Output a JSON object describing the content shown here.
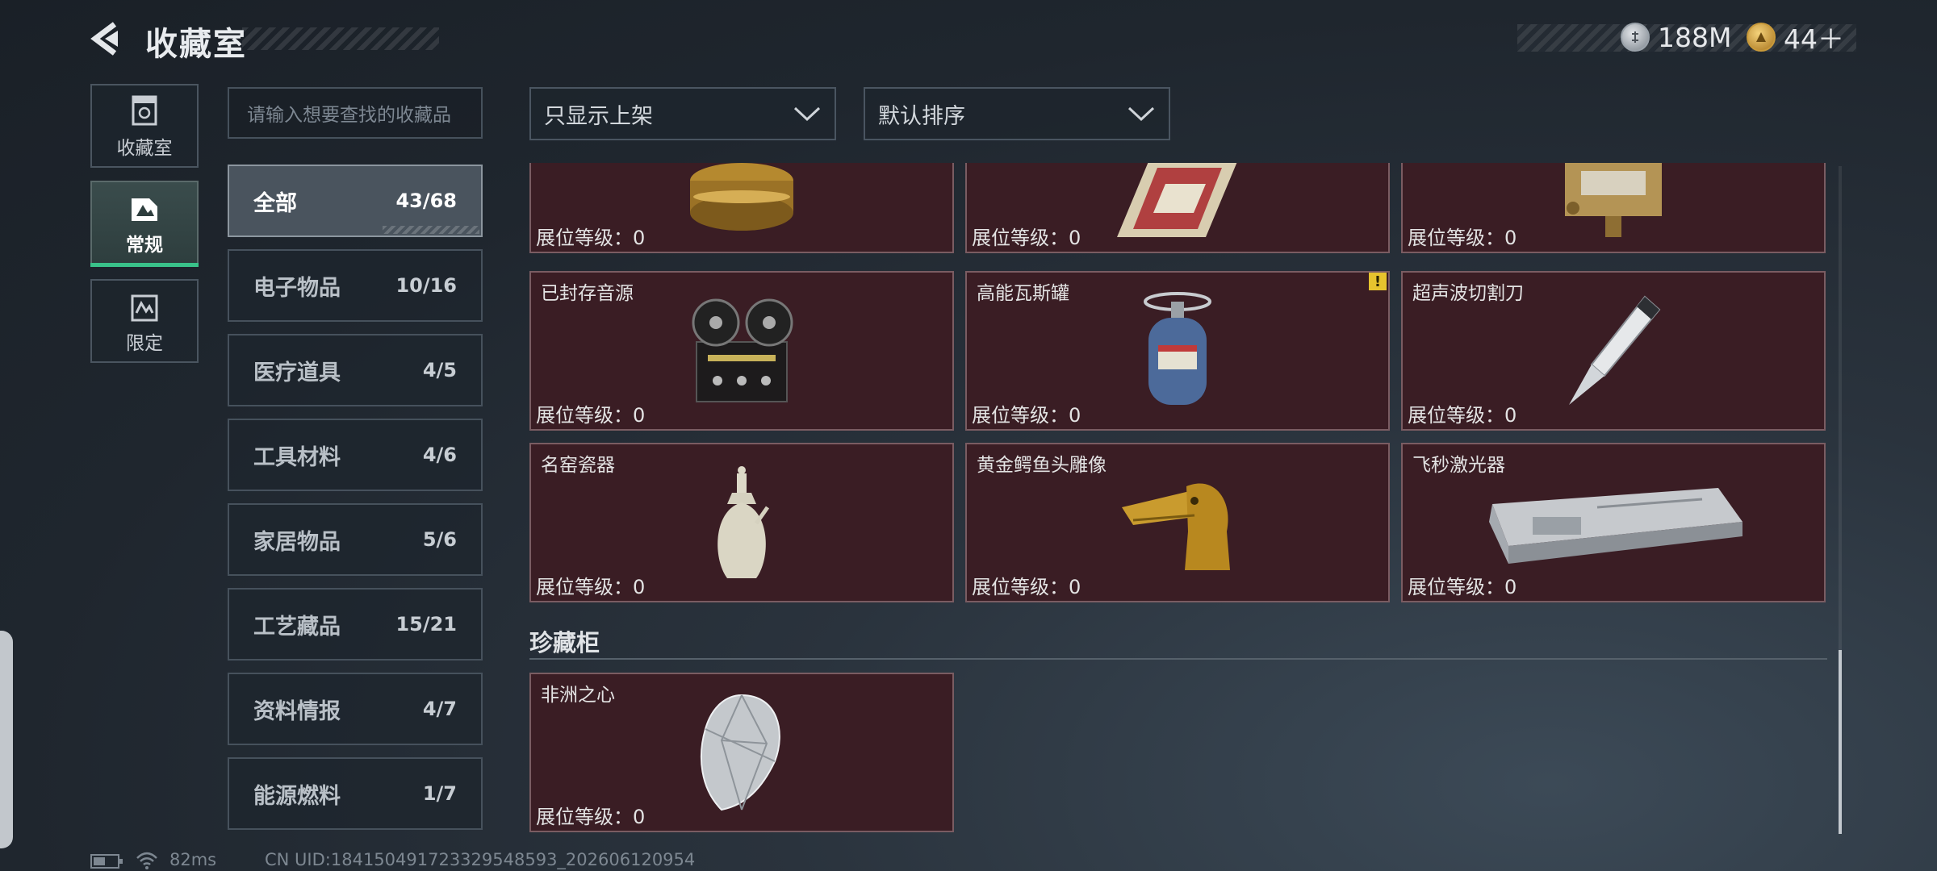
{
  "header": {
    "title": "收藏室"
  },
  "currency": [
    {
      "icon": "silver-coin-icon",
      "value": "188M"
    },
    {
      "icon": "gold-coin-icon",
      "value": "44＋"
    }
  ],
  "nav": [
    {
      "label": "收藏室",
      "icon": "collection-room-icon",
      "active": false
    },
    {
      "label": "常规",
      "icon": "regular-icon",
      "active": true
    },
    {
      "label": "限定",
      "icon": "limited-icon",
      "active": false
    }
  ],
  "search": {
    "placeholder": "请输入想要查找的收藏品"
  },
  "categories": [
    {
      "name": "全部",
      "count": "43/68",
      "active": true
    },
    {
      "name": "电子物品",
      "count": "10/16"
    },
    {
      "name": "医疗道具",
      "count": "4/5"
    },
    {
      "name": "工具材料",
      "count": "4/6"
    },
    {
      "name": "家居物品",
      "count": "5/6"
    },
    {
      "name": "工艺藏品",
      "count": "15/21"
    },
    {
      "name": "资料情报",
      "count": "4/7"
    },
    {
      "name": "能源燃料",
      "count": "1/7"
    }
  ],
  "filters": {
    "shelf": "只显示上架",
    "sort": "默认排序"
  },
  "level_label": "展位等级：0",
  "cards": [
    {
      "name": "",
      "icon": "gold-tin-icon"
    },
    {
      "name": "",
      "icon": "ornate-box-icon"
    },
    {
      "name": "",
      "icon": "brass-device-icon"
    },
    {
      "name": "已封存音源",
      "icon": "reel-tape-recorder-icon"
    },
    {
      "name": "高能瓦斯罐",
      "icon": "gas-canister-icon",
      "warning": "!"
    },
    {
      "name": "超声波切割刀",
      "icon": "ultrasonic-cutter-icon"
    },
    {
      "name": "名窑瓷器",
      "icon": "porcelain-vase-icon"
    },
    {
      "name": "黄金鳄鱼头雕像",
      "icon": "gold-crocodile-statue-icon"
    },
    {
      "name": "飞秒激光器",
      "icon": "femtosecond-laser-icon"
    }
  ],
  "section": {
    "title": "珍藏柜"
  },
  "treasure": {
    "name": "非洲之心",
    "icon": "diamond-icon"
  },
  "status": {
    "ping": "82ms",
    "uid": "CN UID:18415049172332954859​3_202606120954"
  }
}
